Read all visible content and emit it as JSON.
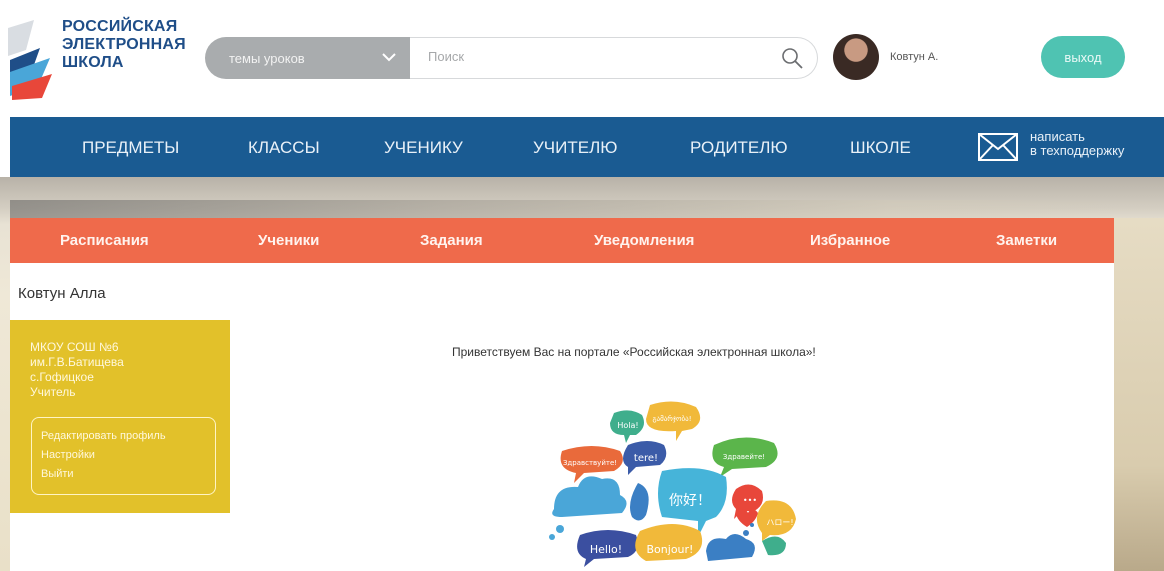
{
  "logo": {
    "line1": "РОССИЙСКАЯ",
    "line2": "ЭЛЕКТРОННАЯ",
    "line3": "ШКОЛА"
  },
  "search": {
    "topics_label": "темы уроков",
    "placeholder": "Поиск"
  },
  "user": {
    "short_name": "Ковтун А.",
    "full_name": "Ковтун Алла",
    "logout_label": "выход"
  },
  "main_nav": {
    "items": [
      "ПРЕДМЕТЫ",
      "КЛАССЫ",
      "УЧЕНИКУ",
      "УЧИТЕЛЮ",
      "РОДИТЕЛЮ",
      "ШКОЛЕ"
    ],
    "support_line1": "написать",
    "support_line2": "в техподдержку"
  },
  "sub_nav": {
    "items": [
      "Расписания",
      "Ученики",
      "Задания",
      "Уведомления",
      "Избранное",
      "Заметки"
    ]
  },
  "profile": {
    "school": "МКОУ СОШ №6",
    "school_name": "им.Г.В.Батищева",
    "location": "с.Гофицкое",
    "role": "Учитель",
    "menu": [
      "Редактировать профиль",
      "Настройки",
      "Выйти"
    ]
  },
  "welcome_text": "Приветствуем Вас на портале «Российская электронная школа»!",
  "bubbles": {
    "hola": "Hola!",
    "georgian": "გამარჯობა!",
    "zdravstvuyte": "Здравствуйте!",
    "tere": "tere!",
    "zdraveite": "Здравейте!",
    "nihao": "你好！",
    "dots": "•••",
    "haro": "ハロー!",
    "hello": "Hello!",
    "bonjour": "Bonjour!"
  },
  "colors": {
    "brand_blue": "#1a5b92",
    "subnav_orange": "#ef6a4b",
    "profile_yellow": "#e2c12a",
    "logout_teal": "#4fc3b2",
    "topic_gray": "#a9acae"
  }
}
